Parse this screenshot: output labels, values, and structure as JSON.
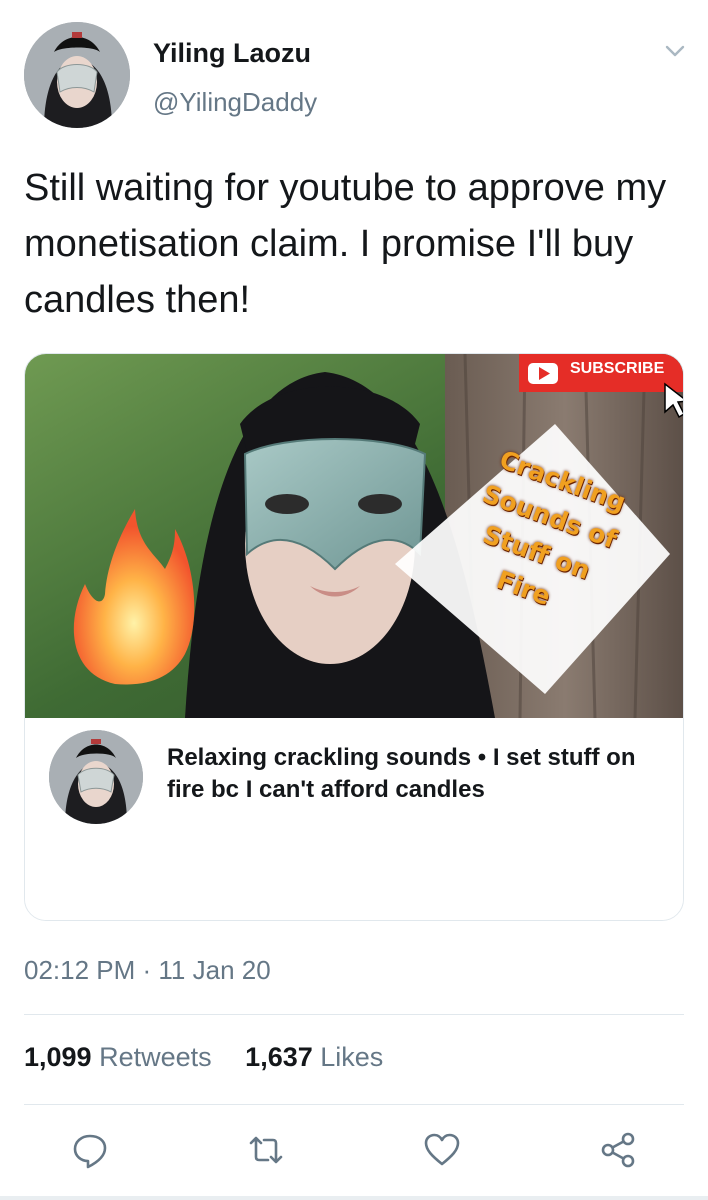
{
  "author": {
    "display_name": "Yiling Laozu",
    "handle": "@YilingDaddy"
  },
  "tweet": {
    "text": "Still waiting for youtube to approve my monetisation claim. I promise I'll buy candles then!",
    "timestamp": "02:12 PM · 11 Jan 20"
  },
  "card": {
    "subscribe_label": "SUBSCRIBE",
    "overlay_lines": [
      "Crackling",
      "Sounds of",
      "Stuff on",
      "Fire"
    ],
    "title": "Relaxing crackling sounds • I set stuff on fire bc I can't afford candles"
  },
  "stats": {
    "retweets_count": "1,099",
    "retweets_label": "Retweets",
    "likes_count": "1,637",
    "likes_label": "Likes"
  },
  "icons": {
    "menu": "chevron-down-icon",
    "reply": "reply-icon",
    "retweet": "retweet-icon",
    "like": "heart-icon",
    "share": "share-icon"
  },
  "colors": {
    "text": "#14171a",
    "secondary": "#657786",
    "border": "#e1e8ed",
    "subscribe_red": "#e52d27"
  }
}
